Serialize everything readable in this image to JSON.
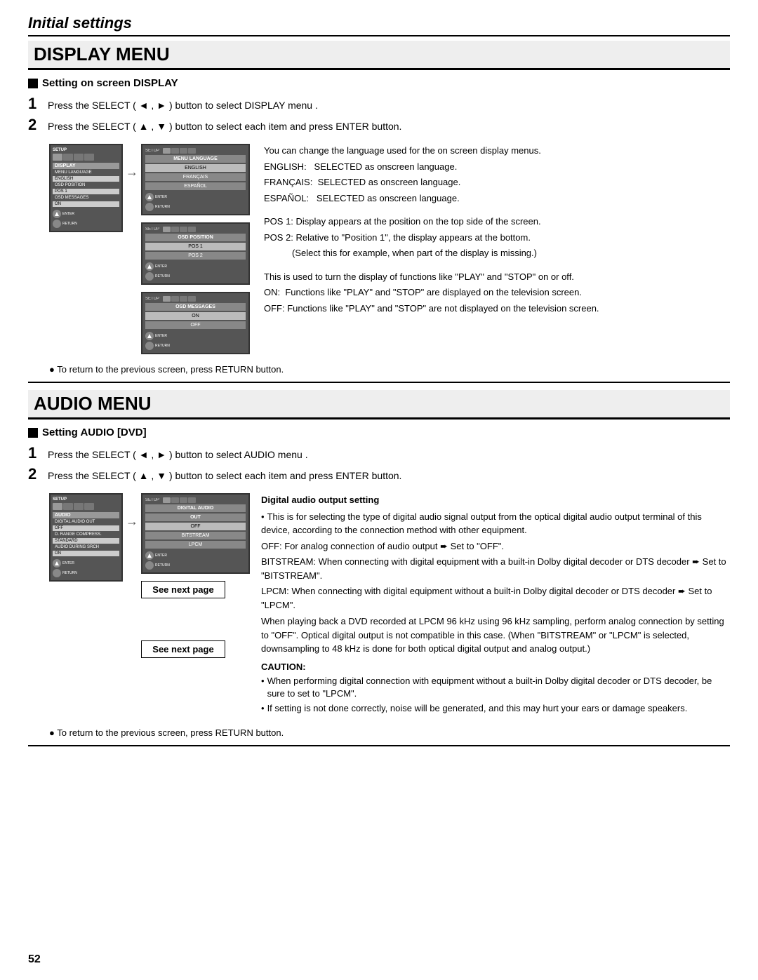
{
  "page": {
    "initial_settings": "Initial settings",
    "page_number": "52"
  },
  "display_menu": {
    "section_title": "DISPLAY MENU",
    "subsection_title": "Setting on screen DISPLAY",
    "step1": "Press the SELECT ( ◄ , ► ) button to select DISPLAY menu .",
    "step2": "Press the SELECT ( ▲ , ▼ ) button to select each item and press ENTER button.",
    "return_note": "● To return to the previous screen, press RETURN button.",
    "screens": {
      "left_small": {
        "label": "SETUP",
        "tab_row": [
          "",
          "",
          "",
          ""
        ],
        "items": [
          {
            "name": "DISPLAY",
            "selected": true
          },
          {
            "name": "MENU LANGUAGE"
          },
          {
            "name": "ENGLISH",
            "highlight": true
          },
          {
            "name": "OSD POSITION"
          },
          {
            "name": "POS 1",
            "highlight": true
          },
          {
            "name": "OSD MESSAGES"
          },
          {
            "name": "ON",
            "highlight": true
          }
        ]
      },
      "right_screens": [
        {
          "label": "SETUP",
          "title": "MENU LANGUAGE",
          "items": [
            {
              "name": "ENGLISH",
              "highlight": true
            },
            {
              "name": "FRANÇAIS"
            },
            {
              "name": "ESPAÑOL"
            }
          ]
        },
        {
          "label": "SETUP",
          "title": "OSD POSITION",
          "items": [
            {
              "name": "POS 1",
              "highlight": true
            },
            {
              "name": "POS 2"
            }
          ]
        },
        {
          "label": "SETUP",
          "title": "OSD MESSAGES",
          "items": [
            {
              "name": "ON",
              "highlight": true
            },
            {
              "name": "OFF"
            }
          ]
        }
      ]
    },
    "descriptions": {
      "menu_language": {
        "intro": "You can change the language used for the on screen display menus.",
        "items": [
          "ENGLISH:   SELECTED as onscreen language.",
          "FRANÇAIS:  SELECTED as onscreen language.",
          "ESPAÑOL:   SELECTED as onscreen language."
        ]
      },
      "osd_position": {
        "items": [
          "POS 1: Display appears at the position on the top side of the screen.",
          "POS 2: Relative to \"Position 1\", the display appears at the bottom.",
          "(Select this for example, when part of the display is missing.)"
        ]
      },
      "osd_messages": {
        "intro": "This is used to turn the display of functions like \"PLAY\" and \"STOP\" on or off.",
        "items": [
          "ON:  Functions like \"PLAY\" and \"STOP\" are displayed on the television screen.",
          "OFF: Functions like \"PLAY\" and \"STOP\" are not displayed on the television screen."
        ]
      }
    }
  },
  "audio_menu": {
    "section_title": "AUDIO MENU",
    "subsection_title": "Setting AUDIO [DVD]",
    "step1": "Press the SELECT ( ◄ , ► ) button to select AUDIO menu .",
    "step2": "Press the SELECT ( ▲ , ▼ ) button to select each item and press ENTER button.",
    "return_note": "● To return to the previous screen, press RETURN button.",
    "see_next_page": "See next page",
    "screens": {
      "left_small": {
        "label": "SETUP",
        "category": "AUDIO",
        "items": [
          {
            "name": "DIGITAL AUDIO OUT"
          },
          {
            "name": "OFF",
            "highlight": true
          },
          {
            "name": "D. RANGE COMPRESS."
          },
          {
            "name": "STANDARD",
            "highlight": true
          },
          {
            "name": "AUDIO DURING SRCH"
          },
          {
            "name": "ON",
            "highlight": true
          }
        ]
      },
      "right_screen": {
        "label": "SETUP",
        "title": "DIGITAL AUDIO",
        "subtitle": "OUT",
        "items": [
          {
            "name": "OFF",
            "highlight": true
          },
          {
            "name": "BITSTREAM"
          },
          {
            "name": "LPCM"
          }
        ]
      }
    },
    "digital_audio": {
      "title": "Digital audio output setting",
      "bullets": [
        "This is for selecting the type of digital audio signal output from the optical digital audio output terminal of this device, according to the connection method with other equipment.",
        "OFF: For analog connection of audio output ➨ Set to \"OFF\".",
        "BITSTREAM: When connecting with digital equipment with a built-in Dolby digital decoder or DTS decoder ➨ Set to \"BITSTREAM\".",
        "LPCM: When connecting with digital equipment without a built-in Dolby digital decoder or DTS decoder ➨ Set to \"LPCM\".",
        "When playing back a DVD recorded at LPCM 96 kHz using 96 kHz sampling, perform analog connection by setting to \"OFF\". Optical digital output is not compatible in this case. (When \"BITSTREAM\" or \"LPCM\" is selected, downsampling to 48 kHz is done for both optical digital output and analog output.)"
      ]
    },
    "caution": {
      "title": "CAUTION:",
      "bullets": [
        "When performing digital connection with equipment without a built-in Dolby digital decoder or DTS decoder, be sure to set to \"LPCM\".",
        "If setting is not done correctly, noise will be generated, and this may hurt your ears or damage speakers."
      ]
    }
  }
}
